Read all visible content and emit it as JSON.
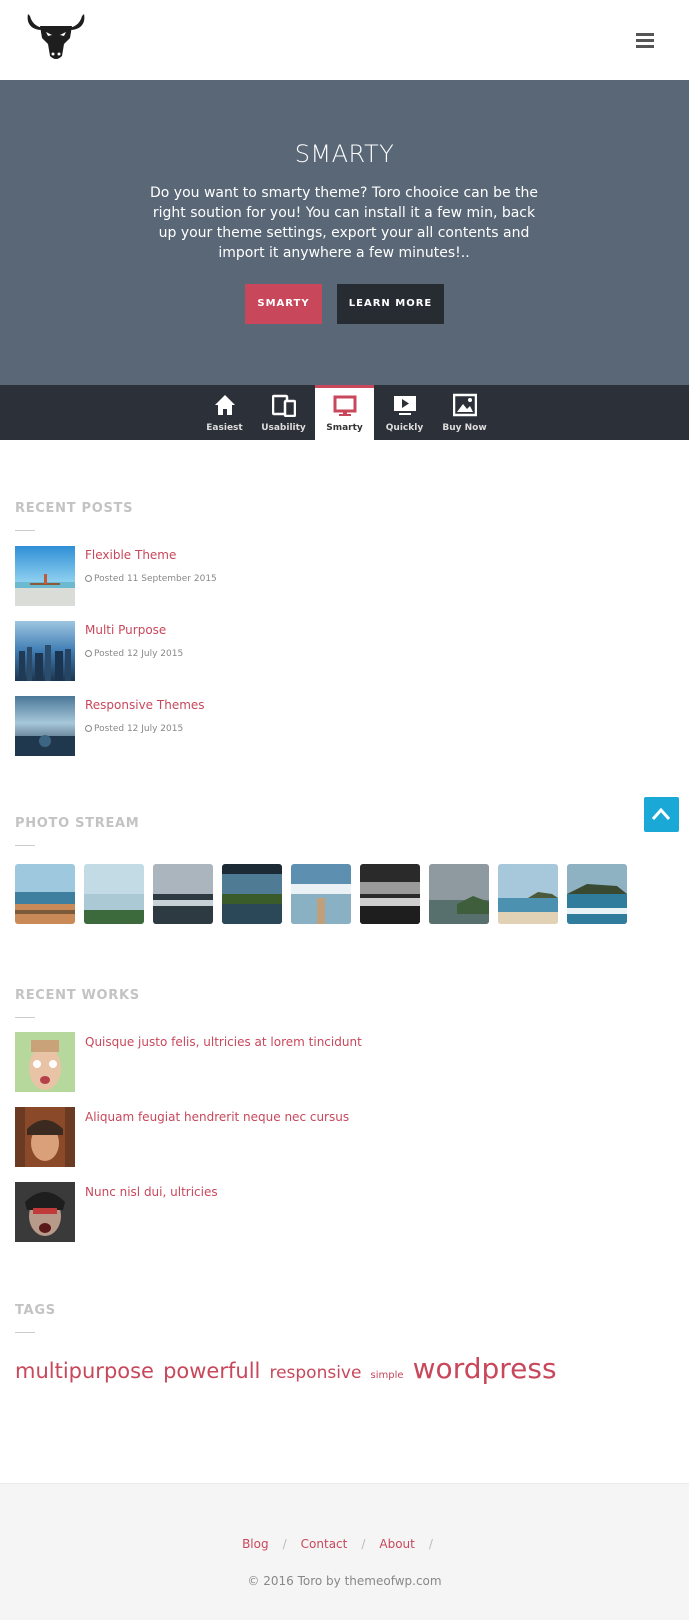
{
  "hero": {
    "title": "SMARTY",
    "text": "Do you want to smarty theme? Toro chooice can be the right soution for you! You can install it a few min, back up your theme settings, export your all contents and import it anywhere a few minutes!..",
    "primary_button": "SMARTY",
    "secondary_button": "LEARN MORE"
  },
  "tabs": [
    {
      "label": "Easiest",
      "icon": "home-icon"
    },
    {
      "label": "Usability",
      "icon": "devices-icon"
    },
    {
      "label": "Smarty",
      "icon": "desktop-icon",
      "active": true
    },
    {
      "label": "Quickly",
      "icon": "play-icon"
    },
    {
      "label": "Buy Now",
      "icon": "image-icon"
    }
  ],
  "recent_posts": {
    "title": "RECENT POSTS",
    "items": [
      {
        "title": "Flexible Theme",
        "meta": "Posted 11 September 2015"
      },
      {
        "title": "Multi Purpose",
        "meta": "Posted 12 July 2015"
      },
      {
        "title": "Responsive Themes",
        "meta": "Posted 12 July 2015"
      }
    ]
  },
  "photo_stream": {
    "title": "PHOTO STREAM",
    "count": 9
  },
  "recent_works": {
    "title": "RECENT WORKS",
    "items": [
      {
        "title": "Quisque justo felis, ultricies at lorem tincidunt"
      },
      {
        "title": "Aliquam feugiat hendrerit neque nec cursus"
      },
      {
        "title": "Nunc nisl dui, ultricies"
      }
    ]
  },
  "tags": {
    "title": "TAGS",
    "items": [
      "multipurpose",
      "powerfull",
      "responsive",
      "simple",
      "wordpress"
    ]
  },
  "footer": {
    "links": [
      "Blog",
      "Contact",
      "About"
    ],
    "copyright": "© 2016 Toro by themeofwp.com"
  },
  "colors": {
    "accent": "#c8475b",
    "hero_bg": "#596776",
    "tabs_bg": "#2c3038",
    "scroll_top": "#1aa9d6"
  }
}
